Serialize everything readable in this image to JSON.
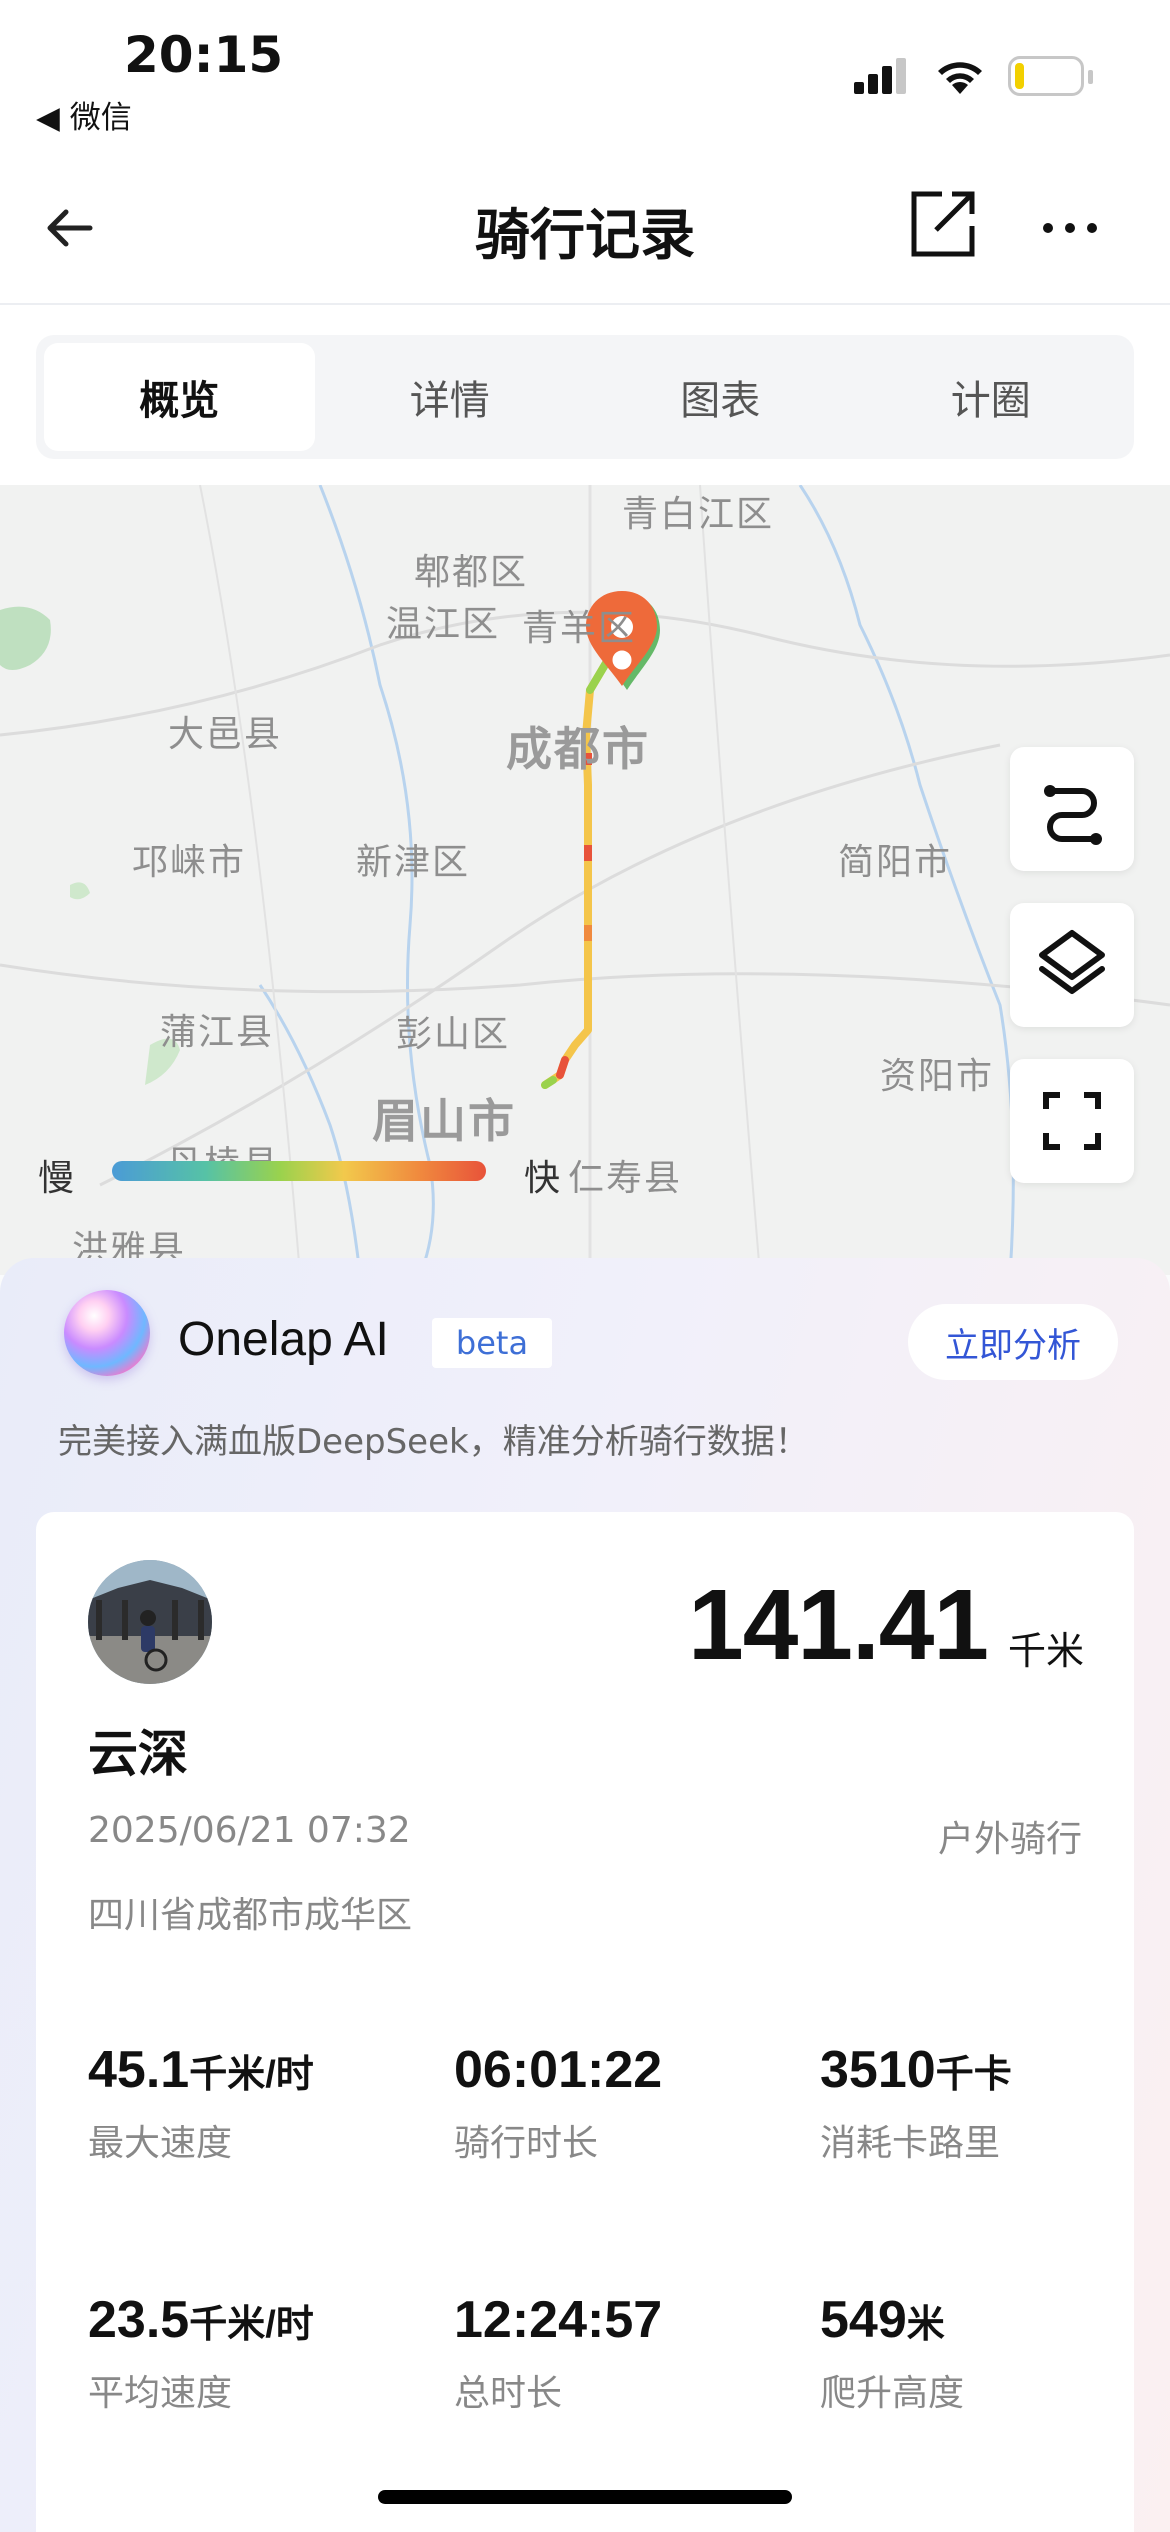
{
  "status_bar": {
    "time": "20:15",
    "back_app": "◀ 微信"
  },
  "nav": {
    "title": "骑行记录"
  },
  "tabs": [
    {
      "label": "概览",
      "active": true
    },
    {
      "label": "详情",
      "active": false
    },
    {
      "label": "图表",
      "active": false
    },
    {
      "label": "计圈",
      "active": false
    }
  ],
  "map": {
    "labels": {
      "qingbaijiang": "青白江区",
      "pidu": "郫都区",
      "wenjiang": "温江区",
      "qingyang": "青羊区",
      "chengdu": "成都市",
      "dayi": "大邑县",
      "qionglai": "邛崃市",
      "xinjin": "新津区",
      "jianyang": "简阳市",
      "pujiang": "蒲江县",
      "pengshan": "彭山区",
      "ziyang": "资阳市",
      "meishan": "眉山市",
      "danleng": "丹棱县",
      "renshou": "仁寿县",
      "hongya": "洪雅县"
    },
    "legend": {
      "slow": "慢",
      "fast": "快"
    }
  },
  "ai": {
    "name": "Onelap AI",
    "badge": "beta",
    "action": "立即分析",
    "description": "完美接入满血版DeepSeek，精准分析骑行数据！"
  },
  "ride": {
    "distance": "141.41",
    "distance_unit": "千米",
    "user": "云深",
    "date": "2025/06/21 07:32",
    "type": "户外骑行",
    "location": "四川省成都市成华区"
  },
  "stats": [
    {
      "value": "45.1",
      "unit": "千米/时",
      "label": "最大速度"
    },
    {
      "value": "06:01:22",
      "unit": "",
      "label": "骑行时长"
    },
    {
      "value": "3510",
      "unit": "千卡",
      "label": "消耗卡路里"
    },
    {
      "value": "23.5",
      "unit": "千米/时",
      "label": "平均速度"
    },
    {
      "value": "12:24:57",
      "unit": "",
      "label": "总时长"
    },
    {
      "value": "549",
      "unit": "米",
      "label": "爬升高度"
    }
  ]
}
